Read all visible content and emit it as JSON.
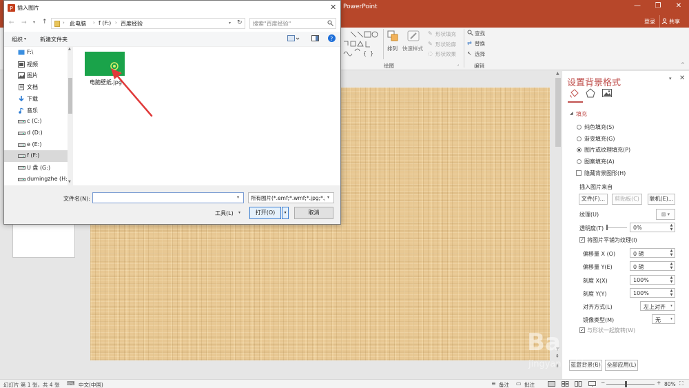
{
  "app": {
    "title": "PowerPoint",
    "window_controls": {
      "minimize": "—",
      "restore": "❐",
      "close": "✕"
    },
    "signin": "登录",
    "share": "共享"
  },
  "ribbon": {
    "drawing": {
      "shape_fill": "形状填充",
      "shape_outline": "形状轮廓",
      "shape_effects": "形状效果",
      "arrange": "排列",
      "quick_styles": "快速样式",
      "group_label": "绘图"
    },
    "editing": {
      "find": "查找",
      "replace": "替换",
      "select": "选择",
      "group_label": "编辑"
    }
  },
  "format_pane": {
    "title": "设置背景格式",
    "section_fill": "填充",
    "options": {
      "solid": "纯色填充(S)",
      "gradient": "渐变填充(G)",
      "picture": "图片或纹理填充(P)",
      "pattern": "图案填充(A)"
    },
    "hide_background": "隐藏背景图形(H)",
    "insert_from": "插入图片来自",
    "btn_file": "文件(F)...",
    "btn_clipboard": "剪贴板(C)",
    "btn_online": "联机(E)...",
    "texture": "纹理(U)",
    "transparency": {
      "label": "透明度(T)",
      "value": "0%"
    },
    "tile_checkbox": "将图片平铺为纹理(I)",
    "offset_x": {
      "label": "偏移量 X (O)",
      "value": "0 磅"
    },
    "offset_y": {
      "label": "偏移量 Y(E)",
      "value": "0 磅"
    },
    "scale_x": {
      "label": "刻度 X(X)",
      "value": "100%"
    },
    "scale_y": {
      "label": "刻度 Y(Y)",
      "value": "100%"
    },
    "alignment": {
      "label": "对齐方式(L)",
      "value": "左上对齐"
    },
    "mirror_type": {
      "label": "镜像类型(M)",
      "value": "无"
    },
    "rotate_with_shape": "与形状一起旋转(W)",
    "btn_reset": "重置背景(B)",
    "btn_apply_all": "全部应用(L)"
  },
  "status": {
    "slide": "幻灯片 第 1 张，共 4 张",
    "language": "中文(中国)",
    "notes": "备注",
    "comments": "批注",
    "zoom": "80%"
  },
  "dialog": {
    "title": "插入图片",
    "breadcrumb": [
      "此电脑",
      "f (F:)",
      "百度经验"
    ],
    "search_placeholder": "搜索\"百度经验\"",
    "organize": "组织",
    "new_folder": "新建文件夹",
    "nav_items": [
      {
        "label": "F:\\",
        "icon": "folder-icon"
      },
      {
        "label": "视频",
        "icon": "video-icon"
      },
      {
        "label": "图片",
        "icon": "pictures-icon"
      },
      {
        "label": "文档",
        "icon": "documents-icon"
      },
      {
        "label": "下载",
        "icon": "download-icon"
      },
      {
        "label": "音乐",
        "icon": "music-icon"
      },
      {
        "label": "c (C:)",
        "icon": "drive-icon"
      },
      {
        "label": "d (D:)",
        "icon": "drive-icon"
      },
      {
        "label": "e (E:)",
        "icon": "drive-icon"
      },
      {
        "label": "f (F:)",
        "icon": "drive-icon"
      },
      {
        "label": "U 盘 (G:)",
        "icon": "drive-icon"
      },
      {
        "label": "dumingzhe (H:)",
        "icon": "drive-icon"
      }
    ],
    "selected_nav_index": 9,
    "file_name": "电脑壁纸.jpg",
    "filename_label": "文件名(N):",
    "filename_value": "",
    "filetype": "所有图片(*.emf;*.wmf;*.jpg;*.j",
    "tools": "工具(L)",
    "open": "打开(O)",
    "cancel": "取消"
  },
  "colors": {
    "brand": "#b7472a",
    "thumb_green": "#1aa34a",
    "arrow": "#e03a3a"
  }
}
